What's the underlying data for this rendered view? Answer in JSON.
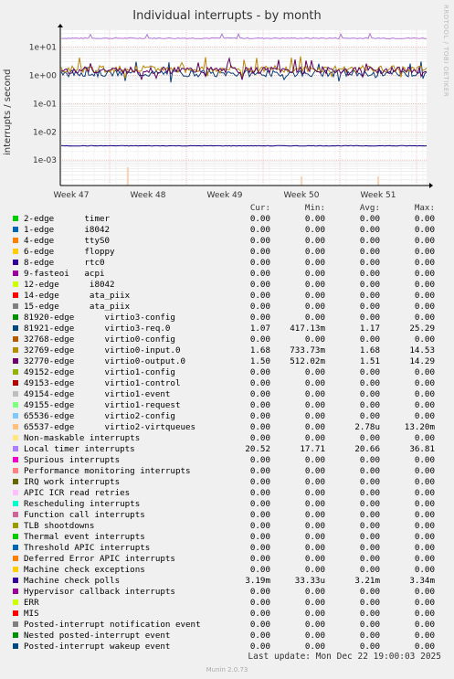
{
  "chart_data": {
    "type": "line",
    "title": "Individual interrupts - by month",
    "ylabel": "interrupts / second",
    "y_scale": "log",
    "y_ticks": [
      "1e+01",
      "1e+00",
      "1e-01",
      "1e-02",
      "1e-03"
    ],
    "x_ticks": [
      "Week 47",
      "Week 48",
      "Week 49",
      "Week 50",
      "Week 51"
    ],
    "grid": true,
    "series": [
      {
        "name": "Local timer interrupts",
        "color": "#b176d7",
        "level": 20.66
      },
      {
        "name": "81921-edge virtio3-req.0",
        "color": "#0a3d7a",
        "level": 1.17
      },
      {
        "name": "32769-edge virtio0-input.0",
        "color": "#b8860b",
        "level": 1.68
      },
      {
        "name": "32770-edge virtio0-output.0",
        "color": "#5c005c",
        "level": 1.51
      },
      {
        "name": "Machine check polls",
        "color": "#1a0088",
        "level": 0.00321
      },
      {
        "name": "65537-edge virtio2-virtqueues",
        "color": "#ffb273",
        "level": 2.8e-06
      }
    ]
  },
  "legend": {
    "headers": {
      "cur": "Cur:",
      "min": "Min:",
      "avg": "Avg:",
      "max": "Max:"
    },
    "rows": [
      {
        "label": "2-edge      timer",
        "color": "#00cc00",
        "cur": "0.00",
        "min": "0.00",
        "avg": "0.00",
        "max": "0.00"
      },
      {
        "label": "1-edge      i8042",
        "color": "#0066b3",
        "cur": "0.00",
        "min": "0.00",
        "avg": "0.00",
        "max": "0.00"
      },
      {
        "label": "4-edge      ttyS0",
        "color": "#ff8000",
        "cur": "0.00",
        "min": "0.00",
        "avg": "0.00",
        "max": "0.00"
      },
      {
        "label": "6-edge      floppy",
        "color": "#ffcc00",
        "cur": "0.00",
        "min": "0.00",
        "avg": "0.00",
        "max": "0.00"
      },
      {
        "label": "8-edge      rtc0",
        "color": "#330099",
        "cur": "0.00",
        "min": "0.00",
        "avg": "0.00",
        "max": "0.00"
      },
      {
        "label": "9-fasteoi   acpi",
        "color": "#990099",
        "cur": "0.00",
        "min": "0.00",
        "avg": "0.00",
        "max": "0.00"
      },
      {
        "label": "12-edge      i8042",
        "color": "#ccff00",
        "cur": "0.00",
        "min": "0.00",
        "avg": "0.00",
        "max": "0.00"
      },
      {
        "label": "14-edge      ata_piix",
        "color": "#ff0000",
        "cur": "0.00",
        "min": "0.00",
        "avg": "0.00",
        "max": "0.00"
      },
      {
        "label": "15-edge      ata_piix",
        "color": "#808080",
        "cur": "0.00",
        "min": "0.00",
        "avg": "0.00",
        "max": "0.00"
      },
      {
        "label": "81920-edge      virtio3-config",
        "color": "#008f00",
        "cur": "0.00",
        "min": "0.00",
        "avg": "0.00",
        "max": "0.00"
      },
      {
        "label": "81921-edge      virtio3-req.0",
        "color": "#00487d",
        "cur": "1.07",
        "min": "417.13m",
        "avg": "1.17",
        "max": "25.29"
      },
      {
        "label": "32768-edge      virtio0-config",
        "color": "#b35a00",
        "cur": "0.00",
        "min": "0.00",
        "avg": "0.00",
        "max": "0.00"
      },
      {
        "label": "32769-edge      virtio0-input.0",
        "color": "#b38f00",
        "cur": "1.68",
        "min": "733.73m",
        "avg": "1.68",
        "max": "14.53"
      },
      {
        "label": "32770-edge      virtio0-output.0",
        "color": "#6b006b",
        "cur": "1.50",
        "min": "512.02m",
        "avg": "1.51",
        "max": "14.29"
      },
      {
        "label": "49152-edge      virtio1-config",
        "color": "#8fb300",
        "cur": "0.00",
        "min": "0.00",
        "avg": "0.00",
        "max": "0.00"
      },
      {
        "label": "49153-edge      virtio1-control",
        "color": "#b30000",
        "cur": "0.00",
        "min": "0.00",
        "avg": "0.00",
        "max": "0.00"
      },
      {
        "label": "49154-edge      virtio1-event",
        "color": "#bebebe",
        "cur": "0.00",
        "min": "0.00",
        "avg": "0.00",
        "max": "0.00"
      },
      {
        "label": "49155-edge      virtio1-request",
        "color": "#80ff80",
        "cur": "0.00",
        "min": "0.00",
        "avg": "0.00",
        "max": "0.00"
      },
      {
        "label": "65536-edge      virtio2-config",
        "color": "#80c9ff",
        "cur": "0.00",
        "min": "0.00",
        "avg": "0.00",
        "max": "0.00"
      },
      {
        "label": "65537-edge      virtio2-virtqueues",
        "color": "#ffc080",
        "cur": "0.00",
        "min": "0.00",
        "avg": "2.78u",
        "max": "13.20m"
      },
      {
        "label": "Non-maskable interrupts",
        "color": "#ffe680",
        "cur": "0.00",
        "min": "0.00",
        "avg": "0.00",
        "max": "0.00"
      },
      {
        "label": "Local timer interrupts",
        "color": "#aa80ff",
        "cur": "20.52",
        "min": "17.71",
        "avg": "20.66",
        "max": "36.81"
      },
      {
        "label": "Spurious interrupts",
        "color": "#ee00cc",
        "cur": "0.00",
        "min": "0.00",
        "avg": "0.00",
        "max": "0.00"
      },
      {
        "label": "Performance monitoring interrupts",
        "color": "#ff8080",
        "cur": "0.00",
        "min": "0.00",
        "avg": "0.00",
        "max": "0.00"
      },
      {
        "label": "IRQ work interrupts",
        "color": "#666600",
        "cur": "0.00",
        "min": "0.00",
        "avg": "0.00",
        "max": "0.00"
      },
      {
        "label": "APIC ICR read retries",
        "color": "#ffbfff",
        "cur": "0.00",
        "min": "0.00",
        "avg": "0.00",
        "max": "0.00"
      },
      {
        "label": "Rescheduling interrupts",
        "color": "#00ffcc",
        "cur": "0.00",
        "min": "0.00",
        "avg": "0.00",
        "max": "0.00"
      },
      {
        "label": "Function call interrupts",
        "color": "#cc6699",
        "cur": "0.00",
        "min": "0.00",
        "avg": "0.00",
        "max": "0.00"
      },
      {
        "label": "TLB shootdowns",
        "color": "#999900",
        "cur": "0.00",
        "min": "0.00",
        "avg": "0.00",
        "max": "0.00"
      },
      {
        "label": "Thermal event interrupts",
        "color": "#00cc00",
        "cur": "0.00",
        "min": "0.00",
        "avg": "0.00",
        "max": "0.00"
      },
      {
        "label": "Threshold APIC interrupts",
        "color": "#0066b3",
        "cur": "0.00",
        "min": "0.00",
        "avg": "0.00",
        "max": "0.00"
      },
      {
        "label": "Deferred Error APIC interrupts",
        "color": "#ff8000",
        "cur": "0.00",
        "min": "0.00",
        "avg": "0.00",
        "max": "0.00"
      },
      {
        "label": "Machine check exceptions",
        "color": "#ffcc00",
        "cur": "0.00",
        "min": "0.00",
        "avg": "0.00",
        "max": "0.00"
      },
      {
        "label": "Machine check polls",
        "color": "#330099",
        "cur": "3.19m",
        "min": "33.33u",
        "avg": "3.21m",
        "max": "3.34m"
      },
      {
        "label": "Hypervisor callback interrupts",
        "color": "#990099",
        "cur": "0.00",
        "min": "0.00",
        "avg": "0.00",
        "max": "0.00"
      },
      {
        "label": "ERR",
        "color": "#ccff00",
        "cur": "0.00",
        "min": "0.00",
        "avg": "0.00",
        "max": "0.00"
      },
      {
        "label": "MIS",
        "color": "#ff0000",
        "cur": "0.00",
        "min": "0.00",
        "avg": "0.00",
        "max": "0.00"
      },
      {
        "label": "Posted-interrupt notification event",
        "color": "#808080",
        "cur": "0.00",
        "min": "0.00",
        "avg": "0.00",
        "max": "0.00"
      },
      {
        "label": "Nested posted-interrupt event",
        "color": "#008f00",
        "cur": "0.00",
        "min": "0.00",
        "avg": "0.00",
        "max": "0.00"
      },
      {
        "label": "Posted-interrupt wakeup event",
        "color": "#00487d",
        "cur": "0.00",
        "min": "0.00",
        "avg": "0.00",
        "max": "0.00"
      }
    ]
  },
  "footer": {
    "last_update": "Last update: Mon Dec 22 19:00:03 2025",
    "munin_version": "Munin 2.0.73",
    "side_credit": "RRDTOOL / TOBI OETIKER"
  }
}
